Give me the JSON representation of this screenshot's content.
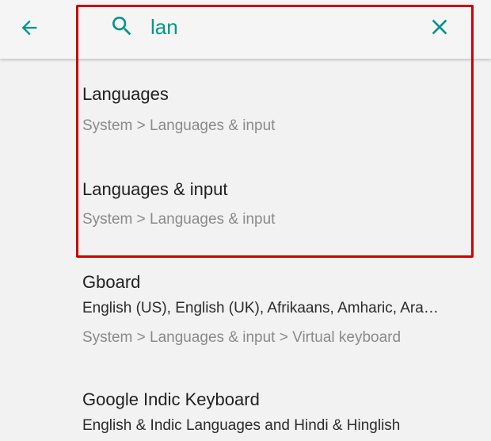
{
  "toolbar": {
    "back_icon": "arrow-back-icon",
    "search_icon": "search-icon",
    "search_value": "lan",
    "clear_icon": "close-icon",
    "accent_color": "#009688"
  },
  "results": [
    {
      "title": "Languages",
      "path": "System > Languages & input"
    },
    {
      "title": "Languages & input",
      "path": "System > Languages & input"
    },
    {
      "title": "Gboard",
      "summary": "English (US), English (UK), Afrikaans, Amharic, Ara…",
      "path": "System > Languages & input > Virtual keyboard"
    },
    {
      "title": "Google Indic Keyboard",
      "summary": "English & Indic Languages and Hindi & Hinglish"
    }
  ],
  "annotation": {
    "highlight_color": "#cc0000"
  }
}
